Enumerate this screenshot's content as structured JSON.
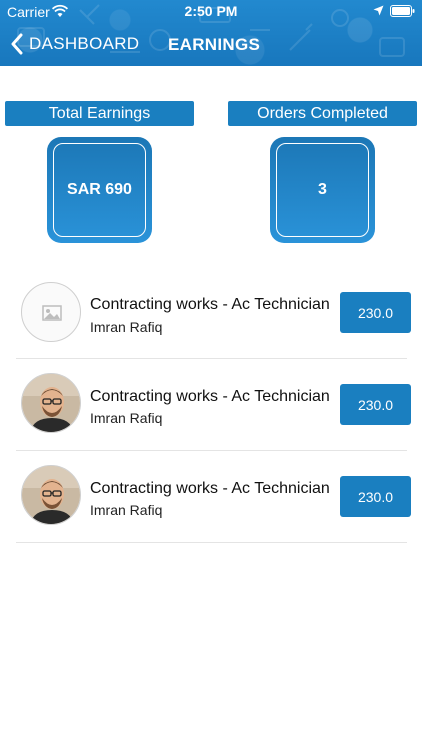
{
  "status_bar": {
    "carrier": "Carrier",
    "time": "2:50 PM"
  },
  "header": {
    "back_label": "DASHBOARD",
    "title": "EARNINGS",
    "color": "#1a7fc6"
  },
  "stats": [
    {
      "label": "Total Earnings",
      "value": "SAR 690"
    },
    {
      "label": "Orders Completed",
      "value": "3"
    }
  ],
  "orders": [
    {
      "title": "Contracting works - Ac Technician",
      "name": "Imran Rafiq",
      "amount": "230.0",
      "avatar": "placeholder-image-icon"
    },
    {
      "title": "Contracting works - Ac Technician",
      "name": "Imran Rafiq",
      "amount": "230.0",
      "avatar": "user-photo"
    },
    {
      "title": "Contracting works - Ac Technician",
      "name": "Imran Rafiq",
      "amount": "230.0",
      "avatar": "user-photo"
    }
  ],
  "colors": {
    "accent": "#1a7fc0",
    "divider": "#e4e4e4"
  }
}
